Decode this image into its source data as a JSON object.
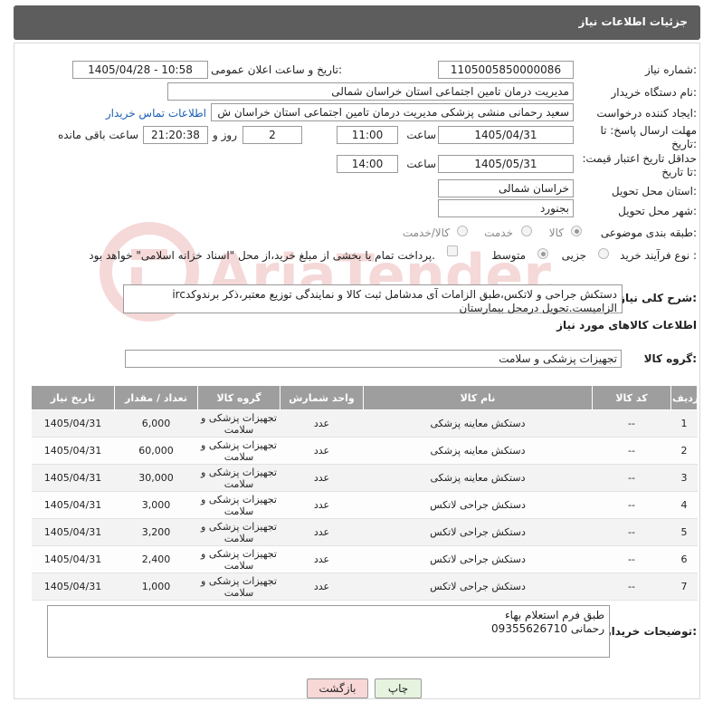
{
  "header": {
    "title": "جزئیات اطلاعات نیاز"
  },
  "form": {
    "need_number_label": "شماره نیاز:",
    "need_number": "1105005850000086",
    "announce_label": "تاریخ و ساعت اعلان عمومی:",
    "announce_value": "1405/04/28 - 10:58",
    "buyer_org_label": "نام دستگاه خریدار:",
    "buyer_org": "مدیریت درمان تامین اجتماعی استان خراسان شمالی",
    "requester_label": "ایجاد کننده درخواست:",
    "requester": "سعید رحمانی منشی پزشکی مدیریت درمان تامین اجتماعی استان خراسان ش",
    "contact_link": "اطلاعات تماس خریدار",
    "reply_deadline_label": "مهلت ارسال پاسخ: تا تاریخ:",
    "reply_date": "1405/04/31",
    "time_label": "ساعت",
    "reply_time": "11:00",
    "days": "2",
    "days_label": "روز و",
    "remaining": "21:20:38",
    "remaining_label": "ساعت باقی مانده",
    "price_validity_label": "حداقل تاریخ اعتبار قیمت: تا تاریخ:",
    "validity_date": "1405/05/31",
    "validity_time": "14:00",
    "province_label": "استان محل تحویل:",
    "province": "خراسان شمالی",
    "city_label": "شهر محل تحویل:",
    "city": "بجنورد",
    "category_label": "طبقه بندی موضوعی:",
    "category_options": [
      "کالا",
      "خدمت",
      "کالا/خدمت"
    ],
    "purchase_type_label": "نوع فرآیند خرید :",
    "purchase_options": [
      "جزیی",
      "متوسط"
    ],
    "payment_note": "پرداخت تمام یا بخشی از مبلغ خرید،از محل \"اسناد خزانه اسلامی\" خواهد بود."
  },
  "summary": {
    "label": "شرح کلی نیاز:",
    "text": "دستکش جراحی و لاتکس،طبق الزامات آی مدشامل ثبت کالا و نمایندگی توزیع معتبر،ذکر برندوکدirc الزامیست.تحویل درمحل بیمارستان"
  },
  "goods": {
    "section_title": "اطلاعات کالاهای مورد نیاز",
    "group_label": "گروه کالا:",
    "group_value": "تجهیزات پزشکی و سلامت"
  },
  "table": {
    "headers": [
      "ردیف",
      "کد کالا",
      "نام کالا",
      "واحد شمارش",
      "گروه کالا",
      "تعداد / مقدار",
      "تاریخ نیاز"
    ],
    "rows": [
      {
        "n": "1",
        "code": "--",
        "name": "دستکش معاینه پزشکی",
        "unit": "عدد",
        "group": "تجهیزات پزشکی و سلامت",
        "qty": "6,000",
        "date": "1405/04/31"
      },
      {
        "n": "2",
        "code": "--",
        "name": "دستکش معاینه پزشکی",
        "unit": "عدد",
        "group": "تجهیزات پزشکی و سلامت",
        "qty": "60,000",
        "date": "1405/04/31"
      },
      {
        "n": "3",
        "code": "--",
        "name": "دستکش معاینه پزشکی",
        "unit": "عدد",
        "group": "تجهیزات پزشکی و سلامت",
        "qty": "30,000",
        "date": "1405/04/31"
      },
      {
        "n": "4",
        "code": "--",
        "name": "دستکش جراحی لاتکس",
        "unit": "عدد",
        "group": "تجهیزات پزشکی و سلامت",
        "qty": "3,000",
        "date": "1405/04/31"
      },
      {
        "n": "5",
        "code": "--",
        "name": "دستکش جراحی لاتکس",
        "unit": "عدد",
        "group": "تجهیزات پزشکی و سلامت",
        "qty": "3,200",
        "date": "1405/04/31"
      },
      {
        "n": "6",
        "code": "--",
        "name": "دستکش جراحی لاتکس",
        "unit": "عدد",
        "group": "تجهیزات پزشکی و سلامت",
        "qty": "2,400",
        "date": "1405/04/31"
      },
      {
        "n": "7",
        "code": "--",
        "name": "دستکش جراحی لاتکس",
        "unit": "عدد",
        "group": "تجهیزات پزشکی و سلامت",
        "qty": "1,000",
        "date": "1405/04/31"
      }
    ]
  },
  "buyer_notes": {
    "label": "توضیحات خریدار:",
    "line1": "طبق فرم استعلام بهاء",
    "line2": "رحمانی 09355626710"
  },
  "buttons": {
    "print": "چاپ",
    "back": "بازگشت"
  },
  "watermark": {
    "text": "AriaTender.net"
  },
  "colors": {
    "header_bg": "#5d5d5d",
    "table_header_bg": "#9e9e9e",
    "back_button_bg": "#f8d7d7",
    "print_button_bg": "#e6f4df",
    "link": "#1a5fb4"
  }
}
